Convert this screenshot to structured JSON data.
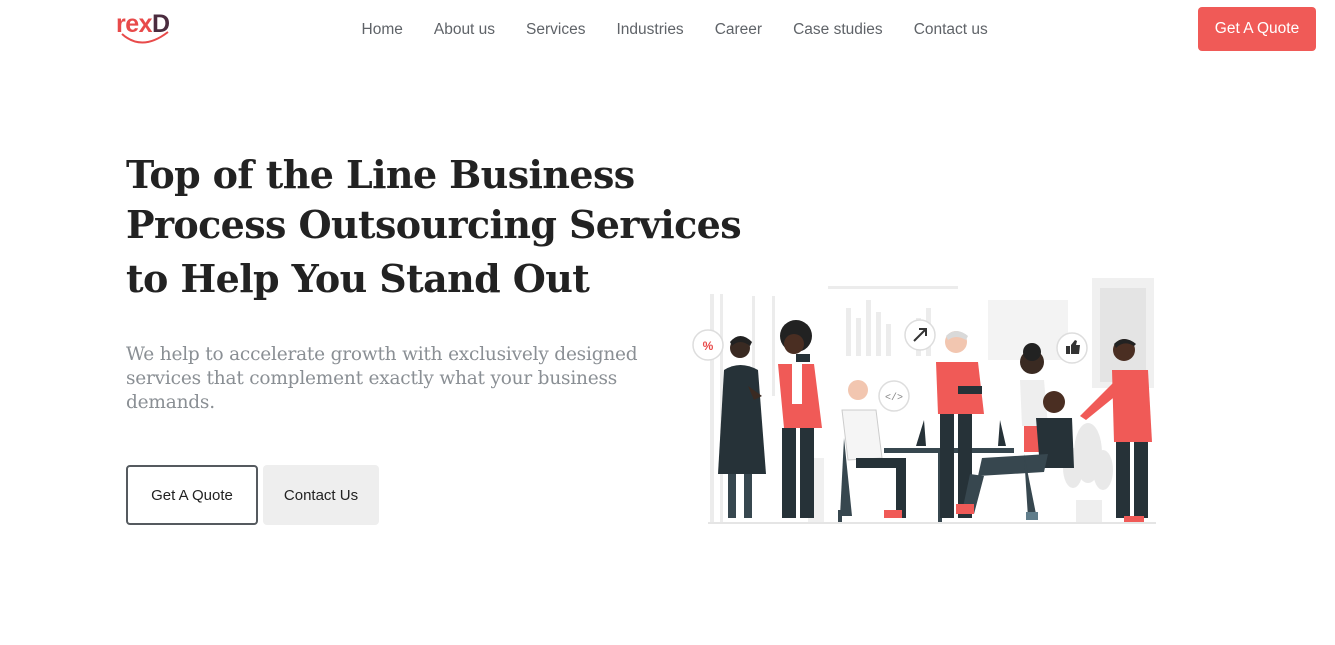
{
  "brand": {
    "logo_text_1": "r",
    "logo_text_2": "ex",
    "logo_text_3": "D",
    "accent_color": "#f05a57",
    "dark_color": "#4b2c3f"
  },
  "nav": {
    "items": [
      {
        "label": "Home"
      },
      {
        "label": "About us"
      },
      {
        "label": "Services"
      },
      {
        "label": "Industries"
      },
      {
        "label": "Career"
      },
      {
        "label": "Case studies"
      },
      {
        "label": "Contact us"
      }
    ],
    "cta_label": "Get A Quote"
  },
  "hero": {
    "title_lines": [
      "Top of the Line Business",
      "Process Outsourcing Services",
      "to Help You Stand Out"
    ],
    "description_lines": [
      "We help to accelerate growth with exclusively designed",
      "services that complement exactly what your business",
      "demands."
    ],
    "primary_button": "Get A Quote",
    "secondary_button": "Contact Us"
  },
  "illustration": {
    "badge_percent": "%",
    "badge_code": "</>",
    "icons": [
      "percent-icon",
      "arrow-up-right-icon",
      "code-icon",
      "thumbs-up-icon"
    ]
  }
}
